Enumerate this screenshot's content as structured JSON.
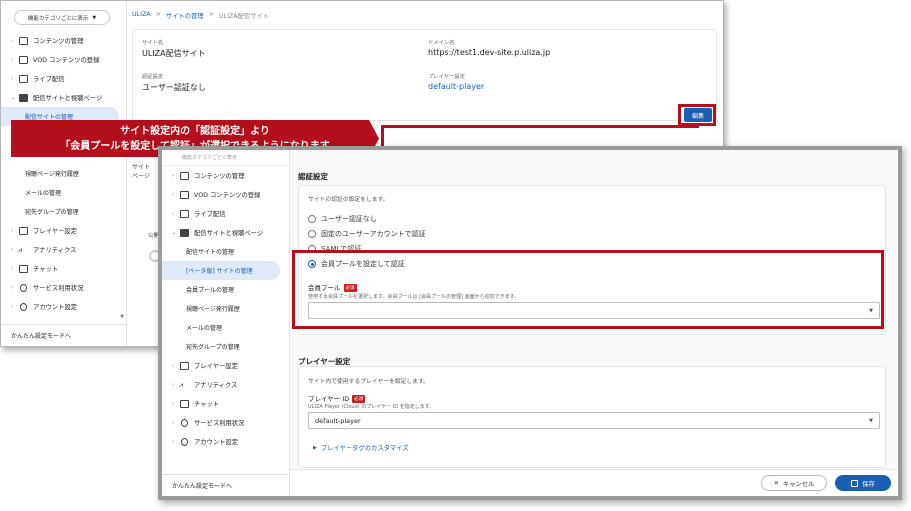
{
  "back": {
    "category_button": "機能カテゴリごとに表示",
    "sidebar": [
      {
        "label": "コンテンツの管理",
        "icon": "content-icon"
      },
      {
        "label": "VOD コンテンツの登録",
        "icon": "vod-icon"
      },
      {
        "label": "ライブ配信",
        "icon": "live-icon"
      },
      {
        "label": "配信サイトと視聴ページ",
        "icon": "site-icon"
      }
    ],
    "sub_items": [
      "配信サイトの管理",
      "視聴ページ発行履歴",
      "メールの管理",
      "宛先グループの管理"
    ],
    "sidebar_rest": [
      {
        "label": "プレイヤー設定",
        "icon": "player-icon"
      },
      {
        "label": "アナリティクス",
        "icon": "analytics-icon"
      },
      {
        "label": "チャット",
        "icon": "chat-icon"
      },
      {
        "label": "サービス利用状況",
        "icon": "usage-icon"
      },
      {
        "label": "アカウント設定",
        "icon": "account-icon"
      }
    ],
    "footer": "かんたん設定モードへ",
    "breadcrumb": [
      "ULIZA",
      "サイトの管理",
      "ULIZA配信サイト"
    ],
    "site_name_label": "サイト名",
    "site_name": "ULIZA配信サイト",
    "domain_label": "ドメイン名",
    "domain": "https://test1.dev-site.p.uliza.jp",
    "auth_label": "認証設定",
    "auth_value": "ユーザー認証なし",
    "player_label": "プレイヤー設定",
    "player_value": "default-player",
    "edit_button": "編集",
    "lower_text_1": "サイト",
    "lower_text_2": "ページ",
    "publish_text": "公開"
  },
  "callout": {
    "line1": "サイト設定内の「認証設定」より",
    "line2": "「会員プールを設定して認証」が選択できるようになります"
  },
  "front": {
    "sidebar_top": "機能カテゴリごとに表示",
    "sidebar": [
      {
        "label": "コンテンツの管理",
        "icon": "content-icon"
      },
      {
        "label": "VOD コンテンツの登録",
        "icon": "vod-icon"
      },
      {
        "label": "ライブ配信",
        "icon": "live-icon"
      },
      {
        "label": "配信サイトと視聴ページ",
        "icon": "site-icon"
      }
    ],
    "sub_items": [
      "配信サイトの管理",
      "[ベータ版] サイトの管理",
      "会員プールの管理",
      "視聴ページ発行履歴",
      "メールの管理",
      "宛先グループの管理"
    ],
    "sidebar_rest": [
      {
        "label": "プレイヤー設定",
        "icon": "player-icon"
      },
      {
        "label": "アナリティクス",
        "icon": "analytics-icon"
      },
      {
        "label": "チャット",
        "icon": "chat-icon"
      },
      {
        "label": "サービス利用状況",
        "icon": "usage-icon"
      },
      {
        "label": "アカウント設定",
        "icon": "account-icon"
      }
    ],
    "footer": "かんたん設定モードへ",
    "auth_heading": "認証設定",
    "auth_desc": "サイトの認証の設定をします。",
    "radio_options": [
      {
        "label": "ユーザー認証なし",
        "selected": false
      },
      {
        "label": "固定のユーザーアカウントで認証",
        "selected": false
      },
      {
        "label": "SAMLで認証",
        "selected": false
      },
      {
        "label": "会員プールを設定して認証",
        "selected": true
      }
    ],
    "pool_label": "会員プール",
    "required": "必須",
    "pool_hint": "使用する会員プールを選択します。会員プールは [会員プールの管理] 画面から追加できます。",
    "pool_value": "",
    "player_heading": "プレイヤー設定",
    "player_desc": "サイト内で使用するプレイヤーを設定します。",
    "player_id_label": "プレイヤー ID",
    "player_id_hint": "ULIZA Player (Cloud) のプレイヤー ID を指定します。",
    "player_id_value": "default-player",
    "customize_link": "プレイヤータグのカスタマイズ",
    "cancel_button": "キャンセル",
    "save_button": "保存"
  }
}
